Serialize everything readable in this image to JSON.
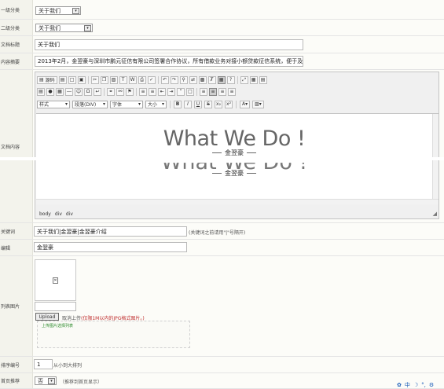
{
  "form": {
    "cat1_label": "一级分类",
    "cat1_value": "关于我们",
    "cat2_label": "二级分类",
    "cat2_value": "关于我们",
    "title_label": "文档标题",
    "title_value": "关于我们",
    "summary_label": "内容摘要",
    "summary_value": "2013年2月，金翌豪与深圳市鹏元征信有限公司签署合作协议，所有借款业务对接小额贷款征信系统，便于及时掌",
    "content_label": "文档内容",
    "keywords_label": "关键词",
    "keywords_value": "关于我们|金翌豪|金翌豪介绍",
    "keywords_hint": "(关键词之前请用\"|\"号隔开)",
    "editor_label": "编辑",
    "editor_value": "金翌豪",
    "image_label": "列表图片",
    "upload_button": "Upload",
    "cancel_upload": "取消上传",
    "upload_hint": "(仅限1M以内的JPG格式图片。)",
    "upload_list_label": "上传图片选择列表",
    "sort_label": "排序编号",
    "sort_value": "1",
    "sort_hint": "从小到大排列",
    "home_label": "首页推荐",
    "home_value": "否",
    "home_hint": "（推荐到首页显示）"
  },
  "editor": {
    "source_label": "源码",
    "style_label": "样式",
    "paragraph_label": "段落(DIV)",
    "font_label": "字体",
    "size_label": "大小",
    "heading": "What We Do !",
    "sub_heading": "金翌豪",
    "path": [
      "body",
      "div",
      "div"
    ]
  },
  "tray": {
    "lang": "中"
  }
}
